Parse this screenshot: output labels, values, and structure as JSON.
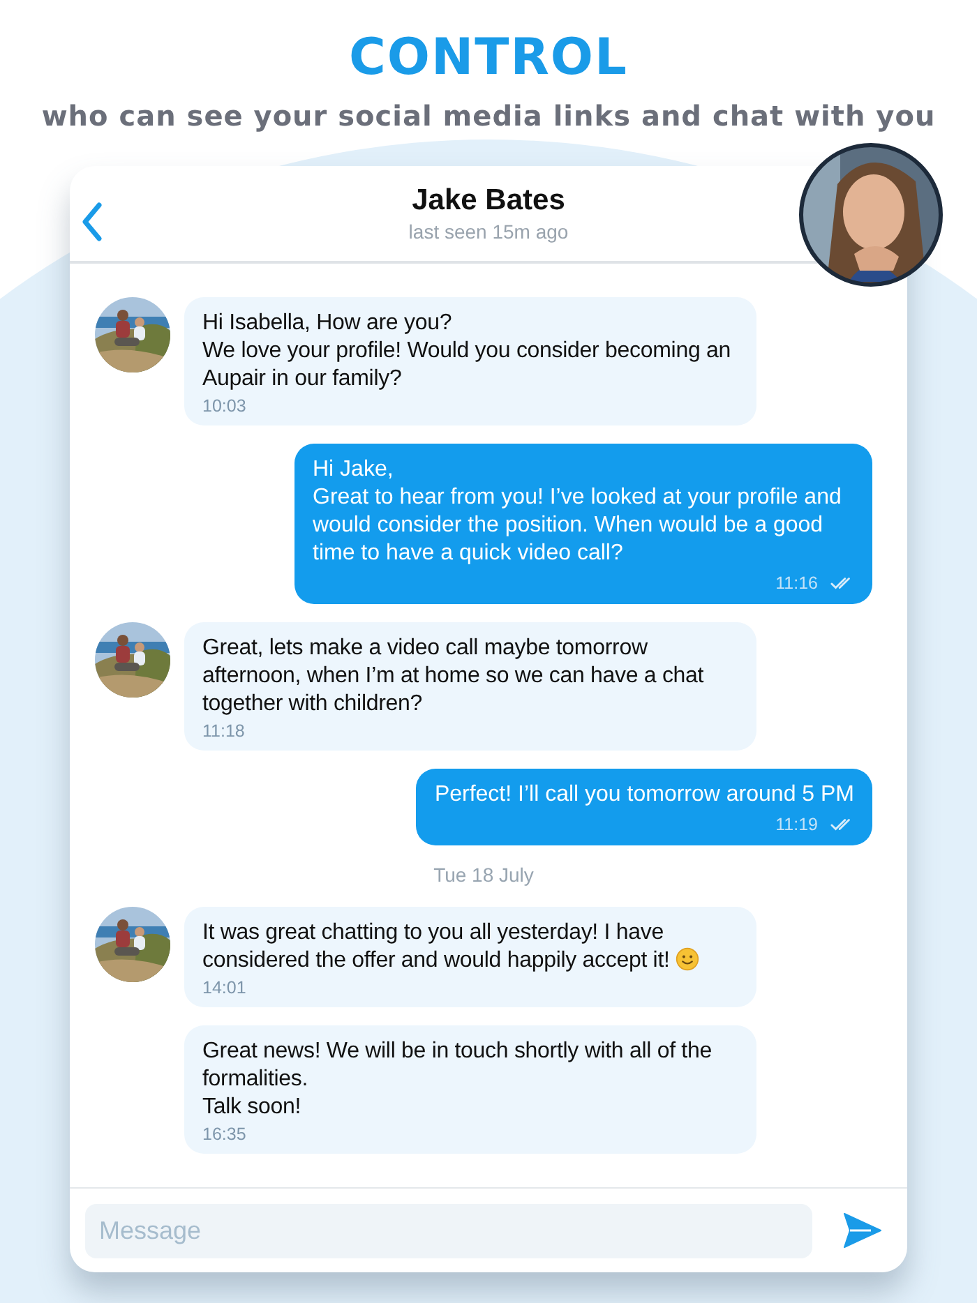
{
  "headline": "CONTROL",
  "subheadline": "who can see your social media links and chat with you",
  "chat": {
    "contact_name": "Jake Bates",
    "status": "last seen 15m ago",
    "messages": [
      {
        "kind": "incoming",
        "avatar": true,
        "text": "Hi Isabella, How are you?\nWe love your profile! Would you consider becoming an Aupair in our family?",
        "time": "10:03"
      },
      {
        "kind": "outgoing",
        "read": true,
        "text": "Hi Jake,\nGreat to hear from you! I’ve looked at your profile and would consider the position. When would be a good time to have a quick video call?",
        "time": "11:16"
      },
      {
        "kind": "incoming",
        "avatar": true,
        "text": "Great, lets make a video call maybe tomorrow afternoon, when I’m at home so we can have a chat together with children?",
        "time": "11:18"
      },
      {
        "kind": "outgoing",
        "read": true,
        "text": "Perfect! I’ll call you tomorrow around 5 PM",
        "time": "11:19"
      },
      {
        "kind": "date",
        "text": "Tue 18 July"
      },
      {
        "kind": "incoming",
        "avatar": true,
        "smiley": true,
        "text": "It was great chatting to you all yesterday! I have considered the offer and would happily accept it!",
        "time": "14:01"
      },
      {
        "kind": "incoming",
        "avatar": false,
        "text": "Great news! We will be in touch shortly with all of the formalities.\nTalk soon!",
        "time": "16:35"
      }
    ],
    "composer": {
      "placeholder": "Message"
    }
  }
}
